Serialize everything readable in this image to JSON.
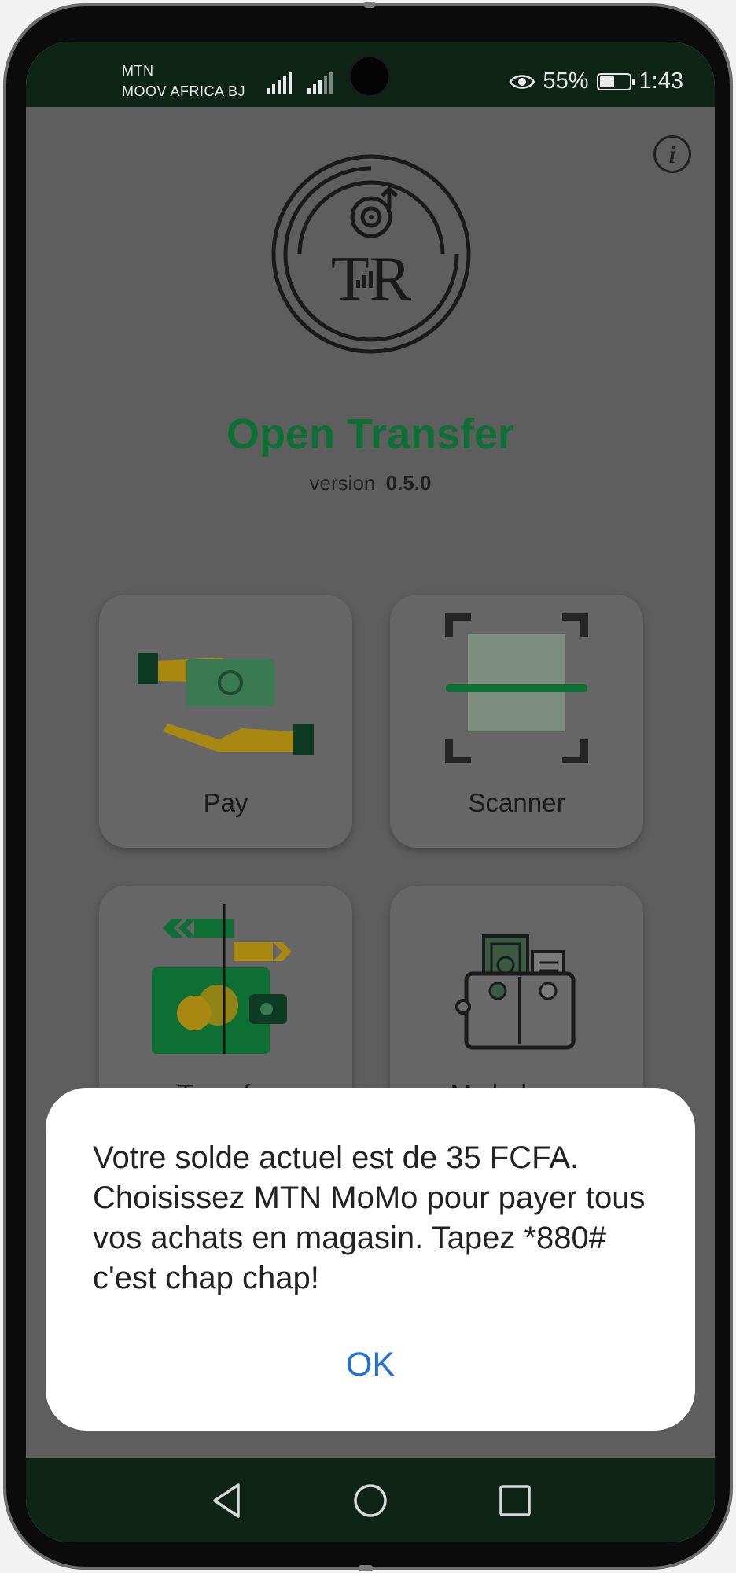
{
  "status_bar": {
    "carrier_1": "MTN",
    "carrier_2": "MOOV AFRICA BJ",
    "battery_percent": "55%",
    "battery_level": 0.55,
    "time": "1:43",
    "icons": [
      "signal-icon",
      "signal-icon",
      "eye-comfort-icon",
      "battery-icon"
    ]
  },
  "app": {
    "name": "Open Transfer",
    "version_label": "version",
    "version_number": "0.5.0",
    "logo_text": "TR",
    "info_icon": "info-icon"
  },
  "tiles": [
    {
      "label": "Pay",
      "icon": "pay-hands-money-icon"
    },
    {
      "label": "Scanner",
      "icon": "qr-scanner-icon"
    },
    {
      "label": "Transfer",
      "icon": "transfer-wallet-icon"
    },
    {
      "label": "My balance",
      "icon": "wallet-balance-icon"
    }
  ],
  "dialog": {
    "message": "Votre solde actuel est de 35 FCFA. Choisissez MTN MoMo pour payer tous vos achats en magasin. Tapez *880# c'est chap chap!",
    "ok_label": "OK"
  },
  "nav_bar": {
    "icons": [
      "back-icon",
      "home-icon",
      "recents-icon"
    ]
  },
  "colors": {
    "status_bar_bg": "#0d2416",
    "brand_green": "#0e6f35",
    "scrim_bg": "#5e5e5e",
    "ok_blue": "#1e6fd9"
  }
}
